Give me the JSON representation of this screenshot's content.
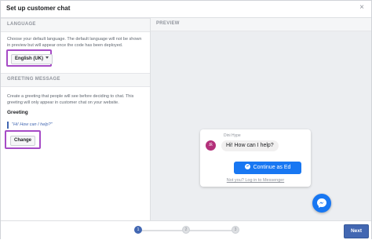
{
  "dialog": {
    "title": "Set up customer chat",
    "close_glyph": "×"
  },
  "language": {
    "heading": "LANGUAGE",
    "description": "Choose your default language. The default language will not be shown in preview but will appear once the code has been deployed.",
    "selected": "English (UK)"
  },
  "greeting": {
    "heading": "GREETING MESSAGE",
    "description": "Create a greeting that people will see before deciding to chat. This greeting will only appear in customer chat on your website.",
    "label": "Greeting",
    "value": "\"Hi! How can I help?\"",
    "change_label": "Change"
  },
  "preview": {
    "heading": "PREVIEW",
    "sender": "Dini Hype",
    "avatar_letter": "Ik",
    "message": "Hi! How can I help?",
    "continue_label": "Continue as Ed",
    "login_link": "Not you? Log in to Messenger",
    "fab_icon": "messenger-icon"
  },
  "footer": {
    "steps": [
      "1",
      "2",
      "3"
    ],
    "active_step": 1,
    "next_label": "Next"
  },
  "colors": {
    "accent": "#4267b2",
    "messenger_blue": "#1877f2",
    "highlight_border": "#a64bc6"
  }
}
